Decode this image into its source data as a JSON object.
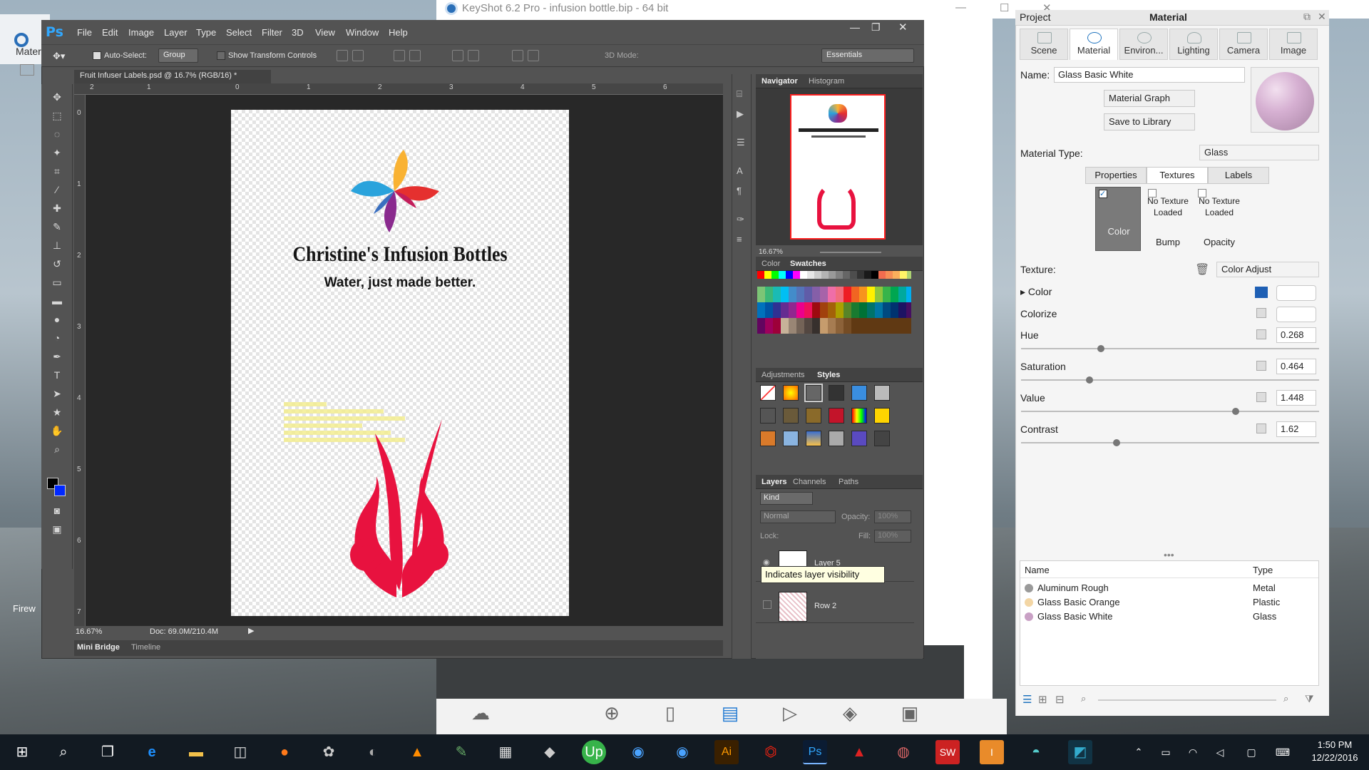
{
  "keyshot": {
    "title": "KeyShot 6.2 Pro - infusion bottle.bip - 64 bit",
    "left_partial_label": "Mater",
    "panel_project": "Project",
    "panel_material": "Material",
    "tabs": [
      "Scene",
      "Material",
      "Environ...",
      "Lighting",
      "Camera",
      "Image"
    ],
    "name_label": "Name:",
    "name_value": "Glass Basic White",
    "material_graph_btn": "Material Graph",
    "save_library_btn": "Save to Library",
    "material_type_label": "Material Type:",
    "material_type_value": "Glass",
    "subtabs": [
      "Properties",
      "Textures",
      "Labels"
    ],
    "texture_slots": [
      {
        "label": "Color",
        "status": ""
      },
      {
        "label": "Bump",
        "status": "No Texture Loaded"
      },
      {
        "label": "Opacity",
        "status": "No Texture Loaded"
      }
    ],
    "texture_label": "Texture:",
    "texture_value": "Color Adjust",
    "props": [
      {
        "label": "Color",
        "value": ""
      },
      {
        "label": "Colorize",
        "value": ""
      },
      {
        "label": "Hue",
        "value": "0.268"
      },
      {
        "label": "Saturation",
        "value": "0.464"
      },
      {
        "label": "Value",
        "value": "1.448"
      },
      {
        "label": "Contrast",
        "value": "1.62"
      }
    ],
    "slider_fractions": {
      "hue": 0.268,
      "saturation": 0.23,
      "value": 0.72,
      "contrast": 0.32
    },
    "list_headers": [
      "Name",
      "Type"
    ],
    "materials": [
      {
        "name": "Aluminum Rough",
        "type": "Metal",
        "color": "#9a9a9a"
      },
      {
        "name": "Glass Basic Orange",
        "type": "Plastic",
        "color": "#f3d6a5"
      },
      {
        "name": "Glass Basic White",
        "type": "Glass",
        "color": "#c9a1c5"
      }
    ],
    "bottom_buttons": [
      "Cloud Library",
      "Import",
      "Library",
      "Project",
      "Animation",
      "KeyShotVR",
      "Render",
      "Screenshot"
    ],
    "accent_color": "#1e73be"
  },
  "photoshop": {
    "logo": "Ps",
    "menu": [
      "File",
      "Edit",
      "Image",
      "Layer",
      "Type",
      "Select",
      "Filter",
      "3D",
      "View",
      "Window",
      "Help"
    ],
    "options": {
      "auto_select_label": "Auto-Select:",
      "auto_select_value": "Group",
      "show_transform": "Show Transform Controls",
      "mode_3d": "3D Mode:",
      "workspace": "Essentials"
    },
    "doc_tab": "Fruit Infuser Labels.psd @ 16.7% (RGB/16) *",
    "ruler_top": [
      "2",
      "1",
      "0",
      "1",
      "2",
      "3",
      "4",
      "5",
      "6"
    ],
    "ruler_left": [
      "0",
      "1",
      "2",
      "3",
      "4",
      "5",
      "6",
      "7"
    ],
    "artboard": {
      "title": "Christine's Infusion Bottles",
      "tagline": "Water, just made better."
    },
    "status": {
      "zoom": "16.67%",
      "doc": "Doc: 69.0M/210.4M"
    },
    "bottom_tabs": [
      "Mini Bridge",
      "Timeline"
    ],
    "navigator_tabs": [
      "Navigator",
      "Histogram"
    ],
    "nav_zoom": "16.67%",
    "color_tabs": [
      "Color",
      "Swatches"
    ],
    "adj_tabs": [
      "Adjustments",
      "Styles"
    ],
    "layers_tabs": [
      "Layers",
      "Channels",
      "Paths"
    ],
    "layers_kind": "Kind",
    "blend_mode": "Normal",
    "opacity_label": "Opacity:",
    "opacity_value": "100%",
    "lock_label": "Lock:",
    "fill_label": "Fill:",
    "fill_value": "100%",
    "layers": [
      "Layer 5",
      "Row 2"
    ],
    "tooltip": "Indicates layer visibility"
  },
  "taskbar": {
    "time": "1:50 PM",
    "date": "12/22/2016"
  },
  "desktop_label": "Firew"
}
